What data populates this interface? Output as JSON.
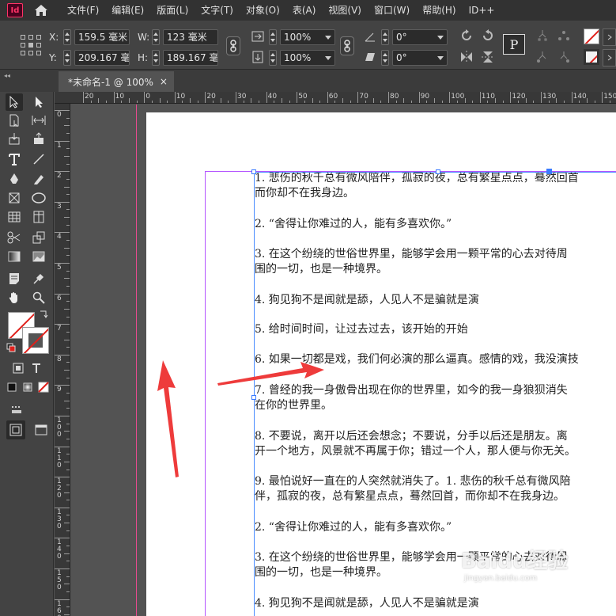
{
  "app": {
    "logo": "Id"
  },
  "menu": [
    "文件(F)",
    "编辑(E)",
    "版面(L)",
    "文字(T)",
    "对象(O)",
    "表(A)",
    "视图(V)",
    "窗口(W)",
    "帮助(H)",
    "ID++"
  ],
  "control": {
    "x_label": "X:",
    "x_value": "159.5 毫米",
    "y_label": "Y:",
    "y_value": "209.167 毫",
    "w_label": "W:",
    "w_value": "123 毫米",
    "h_label": "H:",
    "h_value": "189.167 毫",
    "scale_x": "100%",
    "scale_y": "100%",
    "rotate": "0°",
    "shear": "0°",
    "p_label": "P"
  },
  "tab": {
    "title": "*未命名-1 @ 100%",
    "close": "×"
  },
  "ruler_h_labels": [
    "20",
    "10",
    "0",
    "10",
    "20",
    "30",
    "40",
    "50",
    "60",
    "70",
    "80",
    "90",
    "100",
    "110",
    "120",
    "130",
    "140",
    "150"
  ],
  "ruler_v_labels": [
    "0",
    "1",
    "2",
    "3",
    "4",
    "5",
    "6",
    "7",
    "8",
    "9",
    "100",
    "110",
    "120",
    "130",
    "140",
    "150",
    "160"
  ],
  "text_lines": [
    "1. 悲伤的秋千总有微风陪伴，孤寂的夜，总有繁星点点，蓦然回首",
    "而你却不在我身边。",
    "2. “舍得让你难过的人，能有多喜欢你。”",
    "3. 在这个纷绕的世俗世界里，能够学会用一颗平常的心去对待周",
    "围的一切，也是一种境界。",
    "4. 狗见狗不是闻就是舔，人见人不是骗就是演",
    "5. 给时间时间，让过去过去，该开始的开始",
    "6. 如果一切都是戏，我们何必演的那么逼真。感情的戏，我没演技",
    "7. 曾经的我一身傲骨出现在你的世界里，如今的我一身狼狈消失",
    "在你的世界里。",
    "8. 不要说，离开以后还会想念；不要说，分手以后还是朋友。离",
    "开一个地方，风景就不再属于你；错过一个人，那人便与你无关。",
    "9. 最怕说好一直在的人突然就消失了。1. 悲伤的秋千总有微风陪",
    "伴，孤寂的夜，总有繁星点点，蓦然回首，而你却不在我身边。",
    "2. “舍得让你难过的人，能有多喜欢你。”",
    "3. 在这个纷绕的世俗世界里，能够学会用一颗平常的心去对待周",
    "围的一切，也是一种境界。",
    "4. 狗见狗不是闻就是舔，人见人不是骗就是演"
  ],
  "watermark": {
    "brand": "Baidu",
    "cn": "经验",
    "sub": "jingyan.baidu.com"
  },
  "colors": {
    "accent_arrow": "#ee3b3b",
    "frame": "#4a8cff",
    "margin": "#b455ff",
    "bleed": "#e84a8f"
  }
}
